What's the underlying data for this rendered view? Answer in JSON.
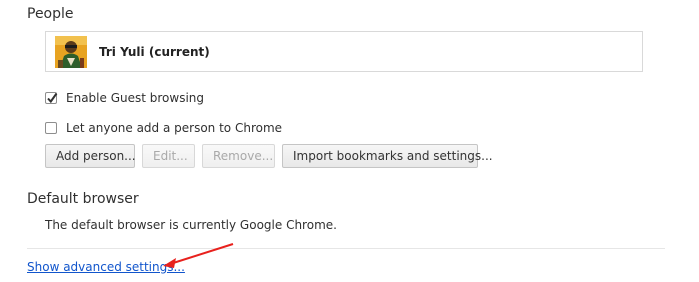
{
  "people": {
    "title": "People",
    "profiles": [
      {
        "name": "Tri Yuli (current)",
        "avatar_icon": "avatar-icon"
      }
    ],
    "guest_browsing": {
      "label": "Enable Guest browsing",
      "checked": true
    },
    "add_person_anyone": {
      "label": "Let anyone add a person to Chrome",
      "checked": false
    },
    "buttons": {
      "add_person": "Add person...",
      "edit": "Edit...",
      "remove": "Remove...",
      "import": "Import bookmarks and settings..."
    }
  },
  "default_browser": {
    "title": "Default browser",
    "status": "The default browser is currently Google Chrome."
  },
  "advanced_link": "Show advanced settings...",
  "colors": {
    "link": "#1155cc",
    "annotation_arrow": "#e8211d",
    "checkmark": "#303030"
  }
}
